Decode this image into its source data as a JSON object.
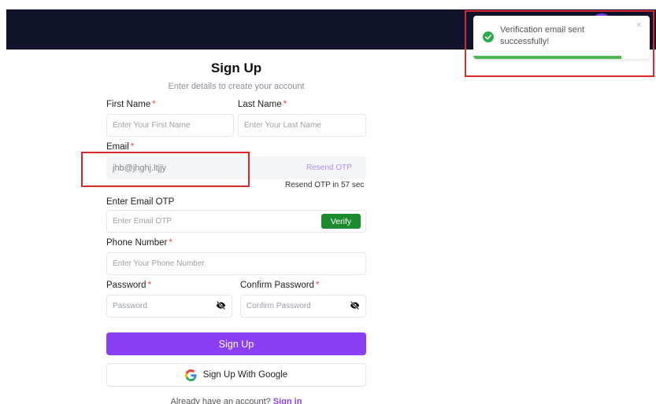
{
  "form": {
    "title": "Sign Up",
    "subtitle": "Enter details to create your account",
    "first_name": {
      "label": "First Name",
      "required": "*",
      "placeholder": "Enter Your First Name"
    },
    "last_name": {
      "label": "Last Name",
      "required": "*",
      "placeholder": "Enter Your Last Name"
    },
    "email": {
      "label": "Email",
      "required": "*",
      "value": "jhb@jhghj.ltjjy",
      "resend_label": "Resend OTP",
      "resend_timer": "Resend OTP in 57 sec"
    },
    "otp": {
      "label": "Enter Email OTP",
      "placeholder": "Enter Email OTP",
      "verify_label": "Verify"
    },
    "phone": {
      "label": "Phone Number",
      "required": "*",
      "placeholder": "Enter Your Phone Number"
    },
    "password": {
      "label": "Password",
      "required": "*",
      "placeholder": "Password"
    },
    "confirm_password": {
      "label": "Confirm Password",
      "required": "*",
      "placeholder": "Confirm Password"
    },
    "submit_label": "Sign Up",
    "google_label": "Sign Up With Google",
    "footer_text": "Already have an account?",
    "footer_link": "Sign in"
  },
  "toast": {
    "message": "Verification email sent successfully!",
    "close_symbol": "×",
    "progress": 0.84
  },
  "colors": {
    "topbar": "#11132a",
    "accent": "#8b3ff5",
    "verify": "#1e8a2e",
    "success": "#4cbb4f",
    "required": "#e5484d",
    "highlight": "#d62a2a"
  },
  "icons": {
    "password_toggle": "eye-slash-icon",
    "confirm_toggle": "eye-slash-icon",
    "google": "google-logo-icon",
    "toast_status": "check-circle-icon"
  }
}
